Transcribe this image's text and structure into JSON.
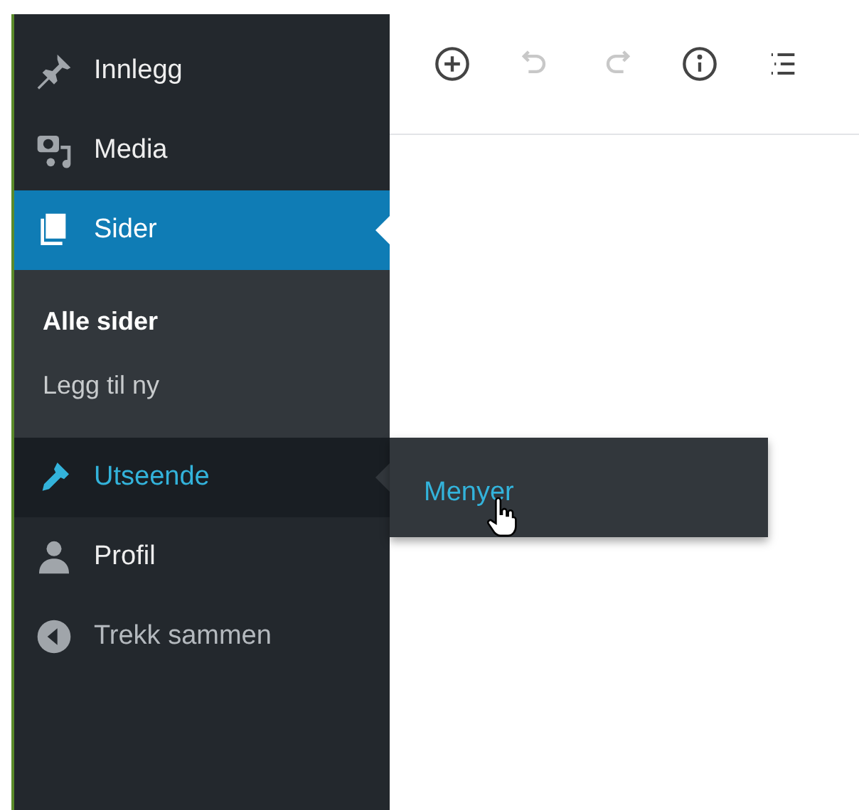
{
  "sidebar": {
    "items": [
      {
        "label": "Innlegg",
        "selected": false,
        "hovered": false
      },
      {
        "label": "Media",
        "selected": false,
        "hovered": false
      },
      {
        "label": "Sider",
        "selected": true,
        "hovered": false,
        "children": [
          {
            "label": "Alle sider",
            "selected": true
          },
          {
            "label": "Legg til ny",
            "selected": false
          }
        ]
      },
      {
        "label": "Utseende",
        "selected": false,
        "hovered": true,
        "flyout": [
          {
            "label": "Menyer",
            "hovered": true
          }
        ]
      },
      {
        "label": "Profil",
        "selected": false,
        "hovered": false
      },
      {
        "label": "Trekk sammen",
        "selected": false,
        "hovered": false,
        "kind": "collapse"
      }
    ]
  },
  "toolbar": {
    "buttons": [
      {
        "disabled": false
      },
      {
        "disabled": true
      },
      {
        "disabled": true
      },
      {
        "disabled": false
      },
      {
        "disabled": false
      }
    ]
  }
}
